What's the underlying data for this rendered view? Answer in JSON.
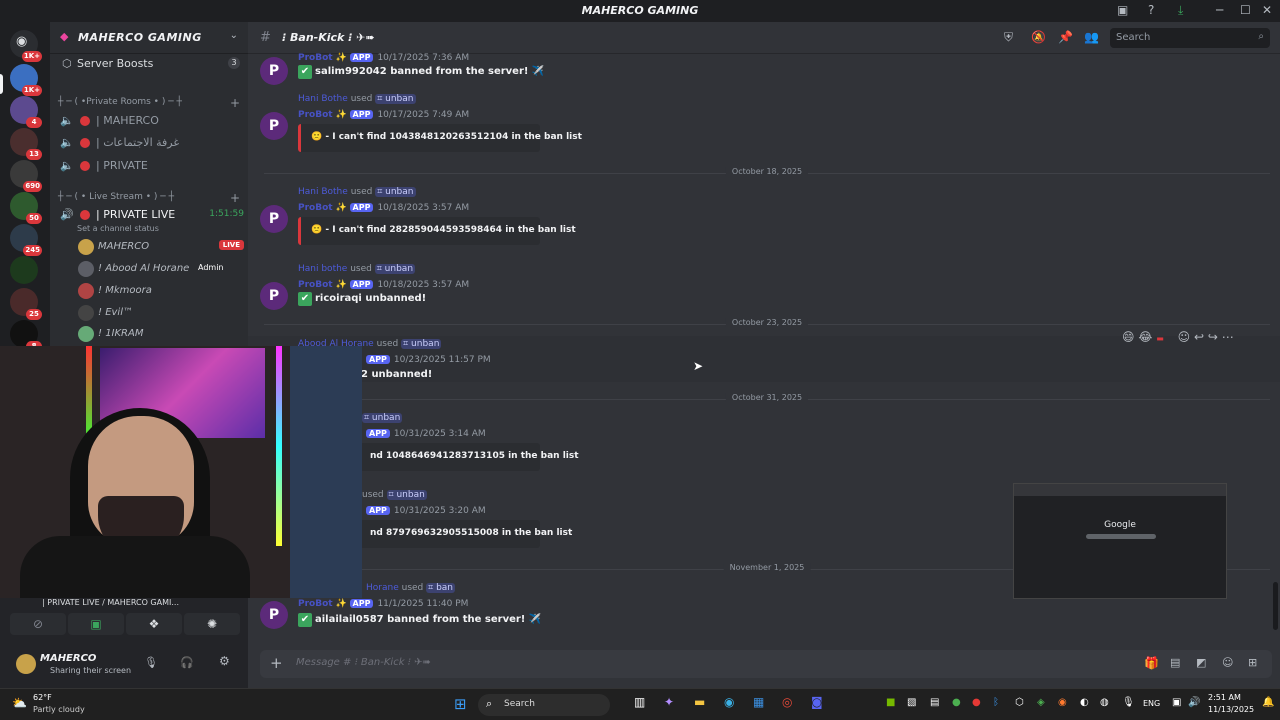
{
  "titlebar": {
    "title": "MAHERCO GAMING"
  },
  "guilds": {
    "badges": [
      "1K+",
      "1K+",
      "4",
      "13",
      "690",
      "50",
      "245",
      "25",
      "8"
    ]
  },
  "sidebar": {
    "server_name": "MAHERCO GAMING",
    "server_boosts": "Server Boosts",
    "server_boosts_count": "3",
    "cat_private_rooms": "┼ ─ ( •Private Rooms • ) ─ ┼",
    "channels_private": [
      "| MAHERCO",
      "| غرفة الاجتماعات",
      "| PRIVATE"
    ],
    "cat_live_stream": "┼ ─ ( • Live Stream • ) ─ ┼",
    "live_channel": "| PRIVATE LIVE",
    "live_timer": "1:51:59",
    "set_status": "Set a channel status",
    "voice_users": [
      {
        "name": "MAHERCO",
        "tag": "LIVE"
      },
      {
        "name": "! Abood Al Horane",
        "tag": "Admin"
      },
      {
        "name": "! Mkmoora",
        "tag": ""
      },
      {
        "name": "! Evil™",
        "tag": ""
      },
      {
        "name": "! 1IKRAM",
        "tag": ""
      }
    ]
  },
  "userpanel": {
    "voice_status": "| PRIVATE LIVE / MAHERCO GAMI...",
    "username": "MAHERCO",
    "status": "Sharing their screen"
  },
  "chat": {
    "channel": "⁝ Ban-Kick ⁝ ✈➠",
    "search_placeholder": "Search",
    "composer_placeholder": "Message # ⁝ Ban-Kick ⁝ ✈➠",
    "bot_name": "ProBot",
    "app_tag": "APP",
    "used": "used",
    "messages": [
      {
        "ts": "10/17/2025 7:36 AM",
        "text": "salim992042 banned from the server! ✈️"
      },
      {
        "reply_user": "Hani Bothe",
        "cmd": "⌗ unban",
        "ts": "10/17/2025 7:49 AM",
        "embed": "🙁 - I can't find 1043848120263512104 in the ban list"
      },
      {
        "reply_user": "Hani Bothe",
        "cmd": "⌗ unban",
        "ts": "10/18/2025 3:57 AM",
        "embed": "🙁 - I can't find 282859044593598464 in the ban list"
      },
      {
        "reply_user": "Hani bothe",
        "cmd": "⌗ unban",
        "ts": "10/18/2025 3:57 AM",
        "text": "ricoiraqi unbanned!"
      },
      {
        "reply_user": "Abood Al Horane",
        "cmd": "⌗ unban",
        "ts": "10/23/2025 11:57 PM",
        "text": "2 unbanned!"
      },
      {
        "cmd": "⌗ unban",
        "ts": "10/31/2025 3:14 AM",
        "embed": "nd 1048646941283713105 in the ban list"
      },
      {
        "reply_user": "",
        "cmd": "⌗ unban",
        "ts": "10/31/2025 3:20 AM",
        "embed": "nd 879769632905515008 in the ban list"
      },
      {
        "reply_user": "Horane",
        "cmd": "⌗ ban",
        "ts": "11/1/2025 11:40 PM",
        "text": "ailailail0587 banned from the server! ✈️"
      }
    ],
    "dates": [
      "October 18, 2025",
      "October 23, 2025",
      "October 31, 2025",
      "November 1, 2025"
    ]
  },
  "mini_preview": {
    "label": "Google"
  },
  "taskbar": {
    "weather_temp": "62°F",
    "weather_desc": "Partly cloudy",
    "search": "Search",
    "lang": "ENG",
    "time": "2:51 AM",
    "date": "11/13/2025"
  }
}
